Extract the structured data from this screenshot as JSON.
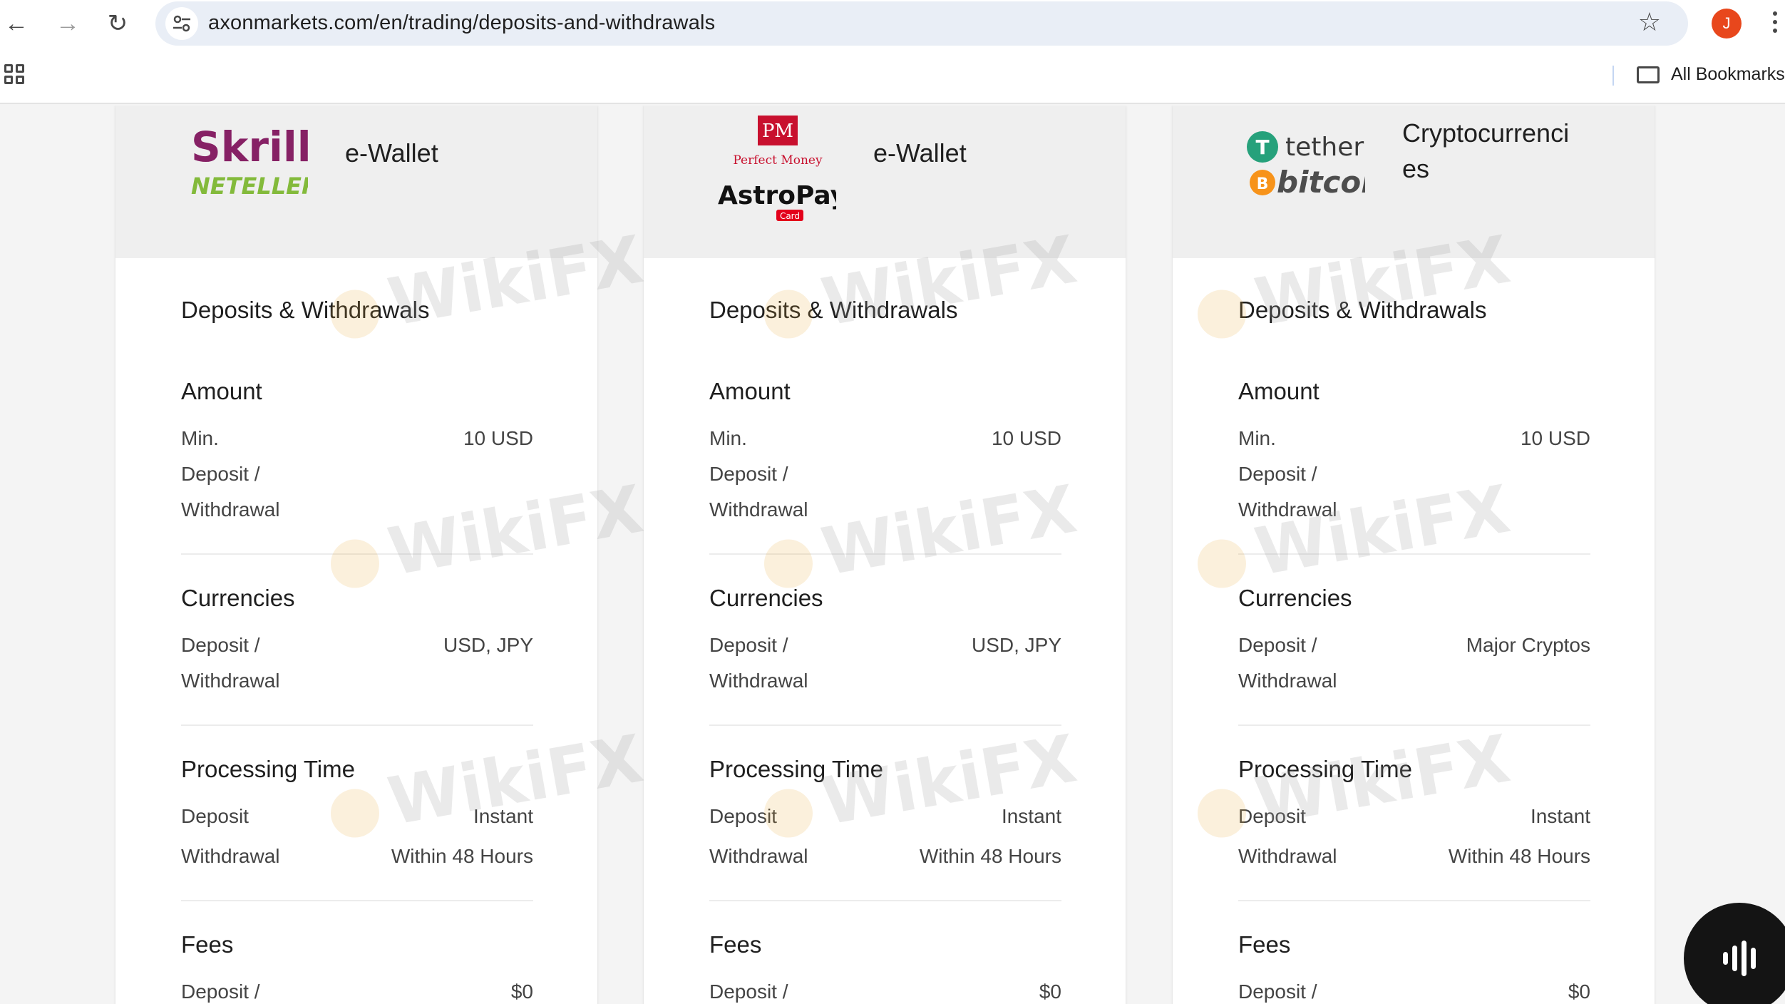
{
  "browser": {
    "url": "axonmarkets.com/en/trading/deposits-and-withdrawals",
    "profile_initial": "J",
    "all_bookmarks": "All Bookmarks"
  },
  "watermark": "WikiFX",
  "cards": [
    {
      "logo_lines": [
        "Skrill",
        "NETELLER"
      ],
      "method": "e-Wallet",
      "section_title": "Deposits & Withdrawals",
      "amount_title": "Amount",
      "amount_label": [
        "Min.",
        "Deposit /",
        "Withdrawal"
      ],
      "amount_value": "10 USD",
      "currencies_title": "Currencies",
      "currencies_label": [
        "Deposit /",
        "Withdrawal"
      ],
      "currencies_value": "USD, JPY",
      "processing_title": "Processing Time",
      "deposit_label": "Deposit",
      "deposit_value": "Instant",
      "withdrawal_label": "Withdrawal",
      "withdrawal_value": "Within 48 Hours",
      "fees_title": "Fees",
      "fees_label": "Deposit /",
      "fees_value": "$0"
    },
    {
      "logo_lines": [
        "PM",
        "Perfect Money",
        "AstroPay",
        "Card"
      ],
      "method": "e-Wallet",
      "section_title": "Deposits & Withdrawals",
      "amount_title": "Amount",
      "amount_label": [
        "Min.",
        "Deposit /",
        "Withdrawal"
      ],
      "amount_value": "10 USD",
      "currencies_title": "Currencies",
      "currencies_label": [
        "Deposit /",
        "Withdrawal"
      ],
      "currencies_value": "USD, JPY",
      "processing_title": "Processing Time",
      "deposit_label": "Deposit",
      "deposit_value": "Instant",
      "withdrawal_label": "Withdrawal",
      "withdrawal_value": "Within 48 Hours",
      "fees_title": "Fees",
      "fees_label": "Deposit /",
      "fees_value": "$0"
    },
    {
      "logo_lines": [
        "tether",
        "bitcoin"
      ],
      "method": "Cryptocurrenci",
      "method2": "es",
      "section_title": "Deposits & Withdrawals",
      "amount_title": "Amount",
      "amount_label": [
        "Min.",
        "Deposit /",
        "Withdrawal"
      ],
      "amount_value": "10 USD",
      "currencies_title": "Currencies",
      "currencies_label": [
        "Deposit /",
        "Withdrawal"
      ],
      "currencies_value": "Major Cryptos",
      "processing_title": "Processing Time",
      "deposit_label": "Deposit",
      "deposit_value": "Instant",
      "withdrawal_label": "Withdrawal",
      "withdrawal_value": "Within 48 Hours",
      "fees_title": "Fees",
      "fees_label": "Deposit /",
      "fees_value": "$0"
    }
  ]
}
